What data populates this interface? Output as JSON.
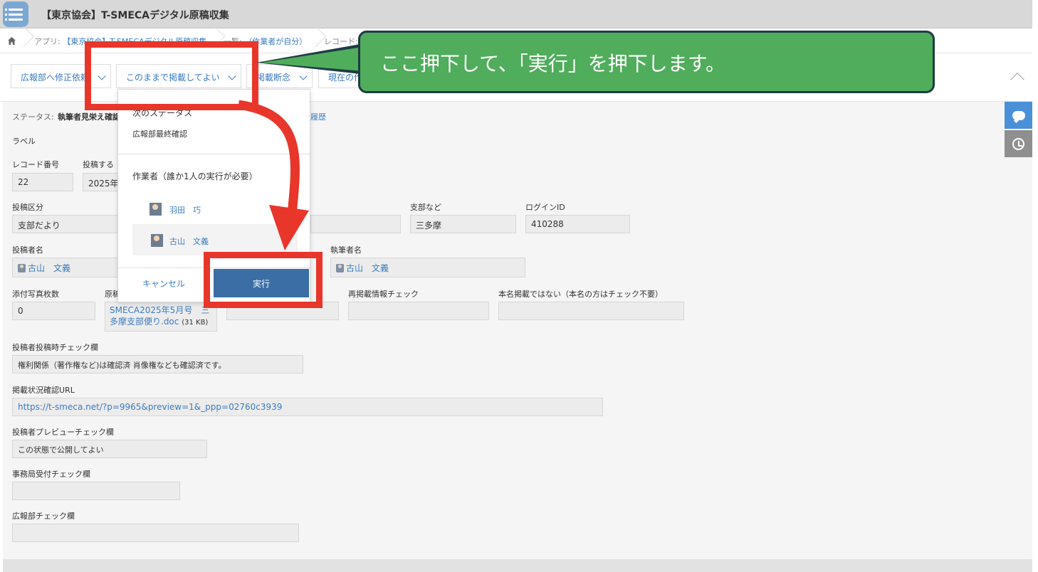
{
  "app": {
    "title": "【東京協会】T-SMECAデジタル原稿収集"
  },
  "breadcrumb": {
    "app_prefix": "アプリ:",
    "app_link": "【東京協会】T-SMECAデジタル原稿収集",
    "list_prefix": "一覧:",
    "list_link": "（作業者が自分）",
    "record_prefix": "レコード:"
  },
  "actions": {
    "btn1": "広報部へ修正依頼",
    "btn2": "このままで掲載してよい",
    "btn3": "掲載断念",
    "btn4": "現在の作"
  },
  "status": {
    "label": "ステータス:",
    "value": "執筆者見栄え確認",
    "history": "履歴"
  },
  "fields": {
    "label_heading": "ラベル",
    "record_no_label": "レコード番号",
    "record_no": "22",
    "post_date_label": "投稿する",
    "post_date": "2025年",
    "category_label": "投稿区分",
    "category": "支部だより",
    "branch_label": "支部など",
    "branch": "三多摩",
    "login_label": "ログインID",
    "login": "410288",
    "poster_label": "投稿者名",
    "poster": "古山　文義",
    "author_label": "執筆者名",
    "author": "古山　文義",
    "photos_label": "添付写真枚数",
    "photos": "0",
    "manuscript_label": "原稿",
    "manuscript_file": "SMECA2025年5月号　三多摩支部便り.doc",
    "manuscript_size": "(31 KB)",
    "repost_label": "再掲載情報チェック",
    "realname_label": "本名掲載ではない（本名の方はチェック不要）",
    "poster_check_label": "投稿者投稿時チェック欄",
    "poster_check": "権利関係（著作権など)は確認済  肖像権なども確認済です。",
    "url_label": "掲載状況確認URL",
    "url": "https://t-smeca.net/?p=9965&preview=1&_ppp=02760c3939",
    "preview_check_label": "投稿者プレビューチェック欄",
    "preview_check": "この状態で公開してよい",
    "office_check_label": "事務局受付チェック欄",
    "pr_check_label": "広報部チェック欄"
  },
  "dropdown": {
    "next_status_heading": "次のステータス",
    "next_status": "広報部最終確認",
    "assignee_heading": "作業者（誰か1人の実行が必要）",
    "users": [
      "羽田　巧",
      "古山　文義"
    ],
    "cancel": "キャンセル",
    "execute": "実行"
  },
  "annotation": {
    "callout_text": "ここ押下して、「実行」を押下します。",
    "colors": {
      "callout_bg": "#4fad5b",
      "highlight": "#e8362b",
      "accent": "#3b7bbf"
    }
  }
}
